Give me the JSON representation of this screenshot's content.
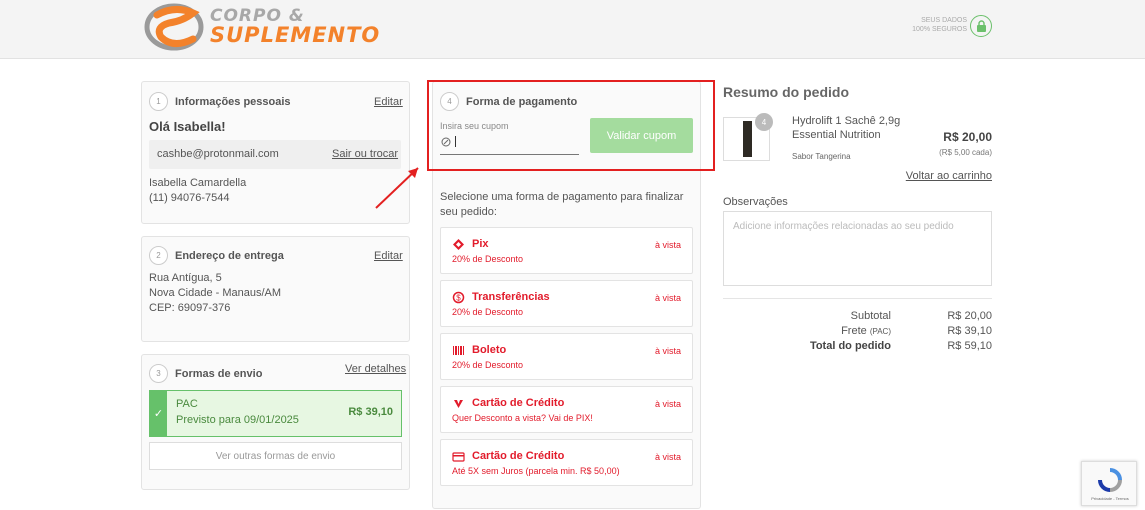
{
  "header": {
    "logo_line1": "CORPO &",
    "logo_line2": "SUPLEMENTO",
    "secure_line1": "SEUS DADOS",
    "secure_line2": "100% SEGUROS"
  },
  "personal": {
    "step": "1",
    "title": "Informações pessoais",
    "edit": "Editar",
    "greeting": "Olá Isabella!",
    "email": "cashbe@protonmail.com",
    "logout": "Sair ou trocar",
    "name": "Isabella Camardella",
    "phone": "(11) 94076-7544"
  },
  "address": {
    "step": "2",
    "title": "Endereço de entrega",
    "edit": "Editar",
    "street": "Rua Antígua, 5",
    "city": "Nova Cidade - Manaus/AM",
    "cep": "CEP: 69097-376"
  },
  "shipping": {
    "step": "3",
    "title": "Formas de envio",
    "details": "Ver detalhes",
    "method": "PAC",
    "eta": "Previsto para 09/01/2025",
    "price": "R$ 39,10",
    "other": "Ver outras formas de envio"
  },
  "payment": {
    "step": "4",
    "title": "Forma de pagamento",
    "coupon_label": "Insira seu cupom",
    "coupon_value": "",
    "validate": "Validar cupom",
    "instruction": "Selecione uma forma de pagamento para finalizar seu pedido:",
    "methods": [
      {
        "name": "Pix",
        "sub": "20% de Desconto",
        "tag": "à vista",
        "icon": "pix-icon"
      },
      {
        "name": "Transferências",
        "sub": "20% de Desconto",
        "tag": "à vista",
        "icon": "transfer-icon"
      },
      {
        "name": "Boleto",
        "sub": "20% de Desconto",
        "tag": "à vista",
        "icon": "barcode-icon"
      },
      {
        "name": "Cartão de Crédito",
        "sub": "Quer Desconto a vista? Vai de PIX!",
        "tag": "à vista",
        "icon": "credit-card-icon"
      },
      {
        "name": "Cartão de Crédito",
        "sub": "Até 5X sem Juros (parcela min. R$ 50,00)",
        "tag": "à vista",
        "icon": "credit-card-icon"
      }
    ]
  },
  "summary": {
    "title": "Resumo do pedido",
    "qty": "4",
    "product_name_1": "Hydrolift 1 Sachê 2,9g",
    "product_name_2": "Essential Nutrition",
    "flavor": "Sabor Tangerina",
    "price": "R$ 20,00",
    "unit_price": "(R$ 5,00 cada)",
    "back_to_cart": "Voltar ao carrinho",
    "notes_label": "Observações",
    "notes_placeholder": "Adicione informações relacionadas ao seu pedido",
    "subtotal_label": "Subtotal",
    "subtotal": "R$ 20,00",
    "freight_label": "Frete",
    "freight_method": "(PAC)",
    "freight": "R$ 39,10",
    "total_label": "Total do pedido",
    "total": "R$ 59,10"
  },
  "recaptcha": {
    "text": "Privacidade - Termos"
  },
  "colors": {
    "accent_red": "#e21b2b",
    "success_green": "#66c16a",
    "logo_orange": "#f3822b"
  }
}
